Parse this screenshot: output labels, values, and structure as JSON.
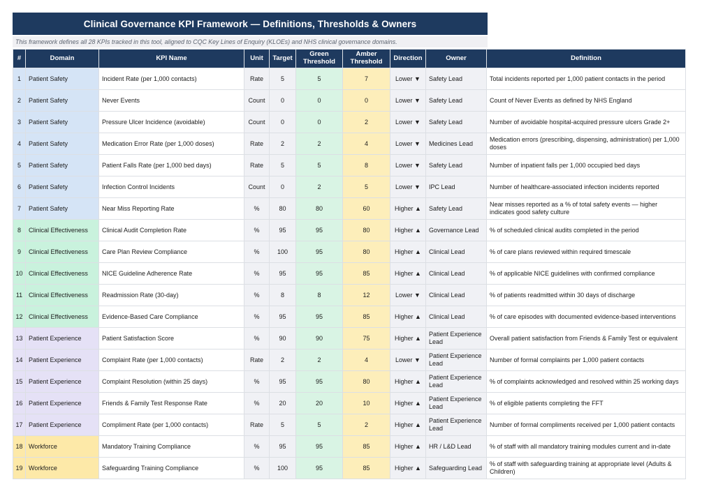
{
  "title": "Clinical Governance KPI Framework — Definitions, Thresholds & Owners",
  "subtitle": "This framework defines all 28 KPIs tracked in this tool, aligned to CQC Key Lines of Enquiry (KLOEs) and NHS clinical governance domains.",
  "colors": {
    "header_bg": "#1e3a5f",
    "header_text": "#ffffff",
    "subtitle_bg": "#f0f0f3",
    "green_cell": "#d9f4e4",
    "amber_cell": "#fdeeba",
    "neutral_cell": "#f0f1f5",
    "domain_colors": {
      "Patient Safety": "#d5e4f6",
      "Clinical Effectiveness": "#c9f2dd",
      "Patient Experience": "#e5e1f6",
      "Workforce": "#fde9a8"
    }
  },
  "table": {
    "columns": [
      {
        "key": "num",
        "label": "#"
      },
      {
        "key": "domain",
        "label": "Domain"
      },
      {
        "key": "kpi",
        "label": "KPI Name"
      },
      {
        "key": "unit",
        "label": "Unit"
      },
      {
        "key": "target",
        "label": "Target"
      },
      {
        "key": "green",
        "label": "Green Threshold"
      },
      {
        "key": "amber",
        "label": "Amber Threshold"
      },
      {
        "key": "direction",
        "label": "Direction"
      },
      {
        "key": "owner",
        "label": "Owner"
      },
      {
        "key": "definition",
        "label": "Definition"
      }
    ],
    "rows": [
      {
        "num": "1",
        "domain": "Patient Safety",
        "kpi": "Incident Rate (per 1,000 contacts)",
        "unit": "Rate",
        "target": "5",
        "green": "5",
        "amber": "7",
        "direction": "Lower ▼",
        "owner": "Safety Lead",
        "definition": "Total incidents reported per 1,000 patient contacts in the period"
      },
      {
        "num": "2",
        "domain": "Patient Safety",
        "kpi": "Never Events",
        "unit": "Count",
        "target": "0",
        "green": "0",
        "amber": "0",
        "direction": "Lower ▼",
        "owner": "Safety Lead",
        "definition": "Count of Never Events as defined by NHS England"
      },
      {
        "num": "3",
        "domain": "Patient Safety",
        "kpi": "Pressure Ulcer Incidence (avoidable)",
        "unit": "Count",
        "target": "0",
        "green": "0",
        "amber": "2",
        "direction": "Lower ▼",
        "owner": "Safety Lead",
        "definition": "Number of avoidable hospital-acquired pressure ulcers Grade 2+"
      },
      {
        "num": "4",
        "domain": "Patient Safety",
        "kpi": "Medication Error Rate (per 1,000 doses)",
        "unit": "Rate",
        "target": "2",
        "green": "2",
        "amber": "4",
        "direction": "Lower ▼",
        "owner": "Medicines Lead",
        "definition": "Medication errors (prescribing, dispensing, administration) per 1,000 doses"
      },
      {
        "num": "5",
        "domain": "Patient Safety",
        "kpi": "Patient Falls Rate (per 1,000 bed days)",
        "unit": "Rate",
        "target": "5",
        "green": "5",
        "amber": "8",
        "direction": "Lower ▼",
        "owner": "Safety Lead",
        "definition": "Number of inpatient falls per 1,000 occupied bed days"
      },
      {
        "num": "6",
        "domain": "Patient Safety",
        "kpi": "Infection Control Incidents",
        "unit": "Count",
        "target": "0",
        "green": "2",
        "amber": "5",
        "direction": "Lower ▼",
        "owner": "IPC Lead",
        "definition": "Number of healthcare-associated infection incidents reported"
      },
      {
        "num": "7",
        "domain": "Patient Safety",
        "kpi": "Near Miss Reporting Rate",
        "unit": "%",
        "target": "80",
        "green": "80",
        "amber": "60",
        "direction": "Higher ▲",
        "owner": "Safety Lead",
        "definition": "Near misses reported as a % of total safety events — higher indicates good safety culture"
      },
      {
        "num": "8",
        "domain": "Clinical Effectiveness",
        "kpi": "Clinical Audit Completion Rate",
        "unit": "%",
        "target": "95",
        "green": "95",
        "amber": "80",
        "direction": "Higher ▲",
        "owner": "Governance Lead",
        "definition": "% of scheduled clinical audits completed in the period"
      },
      {
        "num": "9",
        "domain": "Clinical Effectiveness",
        "kpi": "Care Plan Review Compliance",
        "unit": "%",
        "target": "100",
        "green": "95",
        "amber": "80",
        "direction": "Higher ▲",
        "owner": "Clinical Lead",
        "definition": "% of care plans reviewed within required timescale"
      },
      {
        "num": "10",
        "domain": "Clinical Effectiveness",
        "kpi": "NICE Guideline Adherence Rate",
        "unit": "%",
        "target": "95",
        "green": "95",
        "amber": "85",
        "direction": "Higher ▲",
        "owner": "Clinical Lead",
        "definition": "% of applicable NICE guidelines with confirmed compliance"
      },
      {
        "num": "11",
        "domain": "Clinical Effectiveness",
        "kpi": "Readmission Rate (30-day)",
        "unit": "%",
        "target": "8",
        "green": "8",
        "amber": "12",
        "direction": "Lower ▼",
        "owner": "Clinical Lead",
        "definition": "% of patients readmitted within 30 days of discharge"
      },
      {
        "num": "12",
        "domain": "Clinical Effectiveness",
        "kpi": "Evidence-Based Care Compliance",
        "unit": "%",
        "target": "95",
        "green": "95",
        "amber": "85",
        "direction": "Higher ▲",
        "owner": "Clinical Lead",
        "definition": "% of care episodes with documented evidence-based interventions"
      },
      {
        "num": "13",
        "domain": "Patient Experience",
        "kpi": "Patient Satisfaction Score",
        "unit": "%",
        "target": "90",
        "green": "90",
        "amber": "75",
        "direction": "Higher ▲",
        "owner": "Patient Experience Lead",
        "definition": "Overall patient satisfaction from Friends & Family Test or equivalent"
      },
      {
        "num": "14",
        "domain": "Patient Experience",
        "kpi": "Complaint Rate (per 1,000 contacts)",
        "unit": "Rate",
        "target": "2",
        "green": "2",
        "amber": "4",
        "direction": "Lower ▼",
        "owner": "Patient Experience Lead",
        "definition": "Number of formal complaints per 1,000 patient contacts"
      },
      {
        "num": "15",
        "domain": "Patient Experience",
        "kpi": "Complaint Resolution (within 25 days)",
        "unit": "%",
        "target": "95",
        "green": "95",
        "amber": "80",
        "direction": "Higher ▲",
        "owner": "Patient Experience Lead",
        "definition": "% of complaints acknowledged and resolved within 25 working days"
      },
      {
        "num": "16",
        "domain": "Patient Experience",
        "kpi": "Friends & Family Test Response Rate",
        "unit": "%",
        "target": "20",
        "green": "20",
        "amber": "10",
        "direction": "Higher ▲",
        "owner": "Patient Experience Lead",
        "definition": "% of eligible patients completing the FFT"
      },
      {
        "num": "17",
        "domain": "Patient Experience",
        "kpi": "Compliment Rate (per 1,000 contacts)",
        "unit": "Rate",
        "target": "5",
        "green": "5",
        "amber": "2",
        "direction": "Higher ▲",
        "owner": "Patient Experience Lead",
        "definition": "Number of formal compliments received per 1,000 patient contacts"
      },
      {
        "num": "18",
        "domain": "Workforce",
        "kpi": "Mandatory Training Compliance",
        "unit": "%",
        "target": "95",
        "green": "95",
        "amber": "85",
        "direction": "Higher ▲",
        "owner": "HR / L&D Lead",
        "definition": "% of staff with all mandatory training modules current and in-date"
      },
      {
        "num": "19",
        "domain": "Workforce",
        "kpi": "Safeguarding Training Compliance",
        "unit": "%",
        "target": "100",
        "green": "95",
        "amber": "85",
        "direction": "Higher ▲",
        "owner": "Safeguarding Lead",
        "definition": "% of staff with safeguarding training at appropriate level (Adults & Children)"
      }
    ]
  }
}
